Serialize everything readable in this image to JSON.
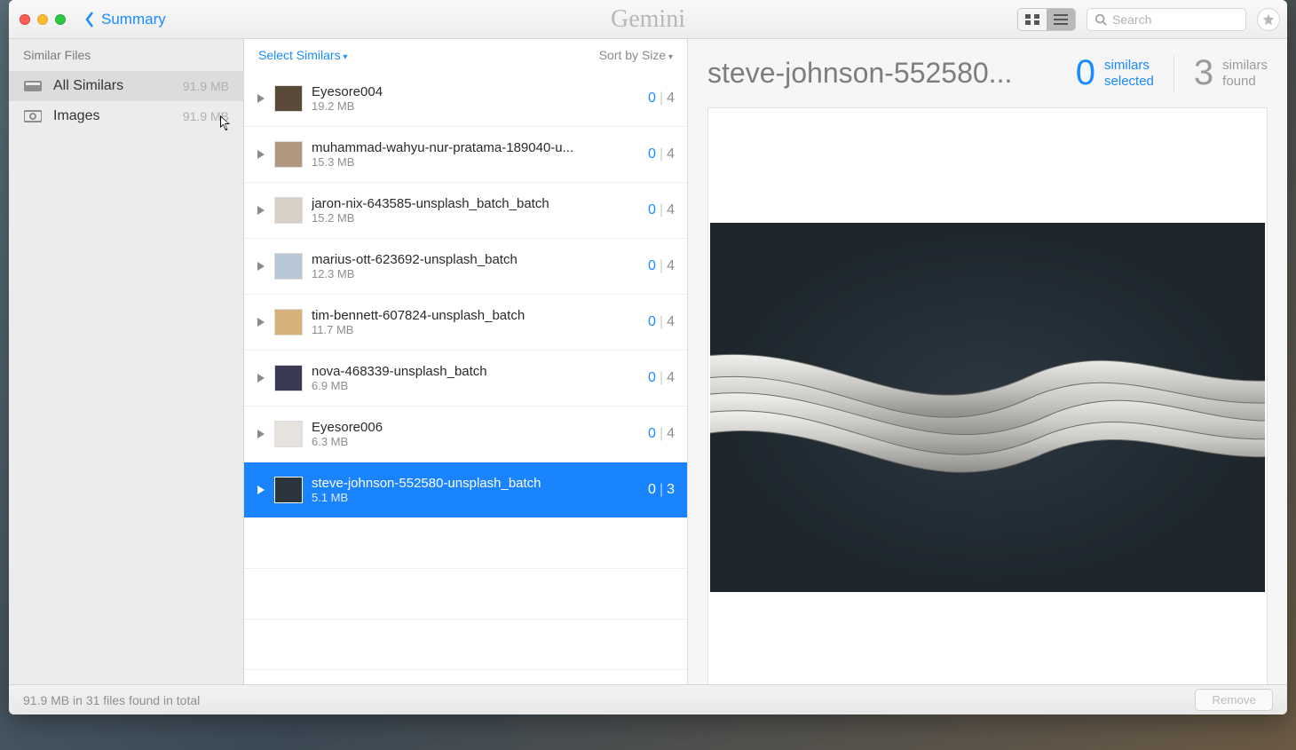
{
  "titlebar": {
    "back_label": "Summary",
    "logo_text": "Gemini",
    "search_placeholder": "Search"
  },
  "sidebar": {
    "header": "Similar Files",
    "items": [
      {
        "label": "All Similars",
        "size": "91.9 MB",
        "selected": true
      },
      {
        "label": "Images",
        "size": "91.9 MB",
        "selected": false
      }
    ]
  },
  "middle": {
    "select_label": "Select Similars",
    "sort_label": "Sort by Size",
    "files": [
      {
        "name": "Eyesore004",
        "size": "19.2 MB",
        "sel": 0,
        "total": 4,
        "selected": false,
        "thumb": "#5a4a3a"
      },
      {
        "name": "muhammad-wahyu-nur-pratama-189040-u...",
        "size": "15.3 MB",
        "sel": 0,
        "total": 4,
        "selected": false,
        "thumb": "#b09880"
      },
      {
        "name": "jaron-nix-643585-unsplash_batch_batch",
        "size": "15.2 MB",
        "sel": 0,
        "total": 4,
        "selected": false,
        "thumb": "#d8cfc6"
      },
      {
        "name": "marius-ott-623692-unsplash_batch",
        "size": "12.3 MB",
        "sel": 0,
        "total": 4,
        "selected": false,
        "thumb": "#b8c7d6"
      },
      {
        "name": "tim-bennett-607824-unsplash_batch",
        "size": "11.7 MB",
        "sel": 0,
        "total": 4,
        "selected": false,
        "thumb": "#d8b07a"
      },
      {
        "name": "nova-468339-unsplash_batch",
        "size": "6.9 MB",
        "sel": 0,
        "total": 4,
        "selected": false,
        "thumb": "#3a3a52"
      },
      {
        "name": "Eyesore006",
        "size": "6.3 MB",
        "sel": 0,
        "total": 4,
        "selected": false,
        "thumb": "#e6e2dd"
      },
      {
        "name": "steve-johnson-552580-unsplash_batch",
        "size": "5.1 MB",
        "sel": 0,
        "total": 3,
        "selected": true,
        "thumb": "#2b343c"
      }
    ]
  },
  "preview": {
    "title": "steve-johnson-552580...",
    "selected_count": 0,
    "selected_label_l1": "similars",
    "selected_label_l2": "selected",
    "found_count": 3,
    "found_label_l1": "similars",
    "found_label_l2": "found"
  },
  "footer": {
    "status": "91.9 MB in 31 files found in total",
    "remove_label": "Remove"
  }
}
